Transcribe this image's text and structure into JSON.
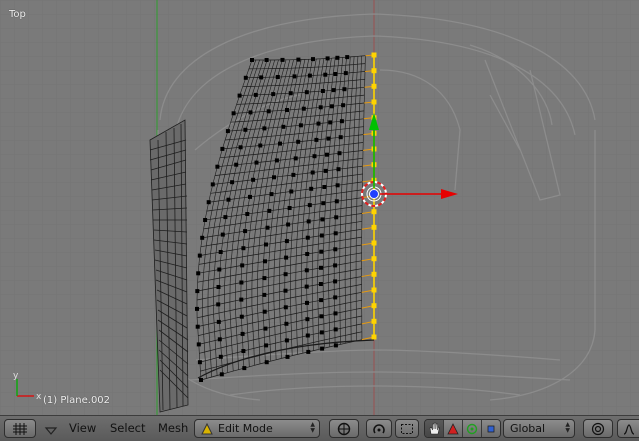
{
  "viewport": {
    "view_name": "Top",
    "object_info": "(1) Plane.002",
    "axis_labels": {
      "x": "x",
      "y": "y"
    }
  },
  "header": {
    "editor_type_icon": "grid-icon",
    "menus": {
      "view": "View",
      "select": "Select",
      "mesh": "Mesh"
    },
    "mode": {
      "icon": "edit-mode-icon",
      "label": "Edit Mode"
    },
    "orientation": {
      "label": "Global"
    }
  },
  "colors": {
    "background": "#7a7a7a",
    "wire": "#1a1a1a",
    "selected": "#ffd400",
    "x_axis": "#e60000",
    "y_axis": "#00b000",
    "header": "#626262"
  }
}
